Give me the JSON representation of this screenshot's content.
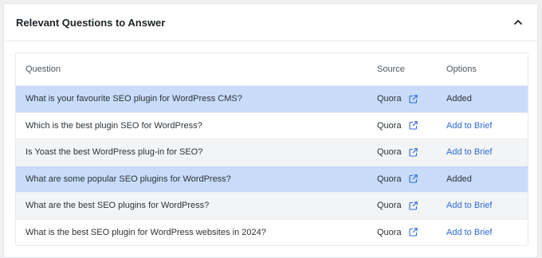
{
  "panel": {
    "title": "Relevant Questions to Answer"
  },
  "table": {
    "headers": {
      "question": "Question",
      "source": "Source",
      "options": "Options"
    },
    "rows": [
      {
        "question": "What is your favourite SEO plugin for WordPress CMS?",
        "source": "Quora",
        "option": "Added",
        "status": "added"
      },
      {
        "question": "Which is the best plugin SEO for WordPress?",
        "source": "Quora",
        "option": "Add to Brief",
        "status": "available"
      },
      {
        "question": "Is Yoast the best WordPress plug-in for SEO?",
        "source": "Quora",
        "option": "Add to Brief",
        "status": "available"
      },
      {
        "question": "What are some popular SEO plugins for WordPress?",
        "source": "Quora",
        "option": "Added",
        "status": "added"
      },
      {
        "question": "What are the best SEO plugins for WordPress?",
        "source": "Quora",
        "option": "Add to Brief",
        "status": "available"
      },
      {
        "question": "What is the best SEO plugin for WordPress websites in 2024?",
        "source": "Quora",
        "option": "Add to Brief",
        "status": "available"
      }
    ]
  },
  "colors": {
    "added_row": "#c8dcfa",
    "striped_row": "#f3f4f5",
    "link": "#2c6bd6"
  },
  "icons": {
    "collapse": "chevron-up-icon",
    "source_link": "external-link-icon"
  }
}
